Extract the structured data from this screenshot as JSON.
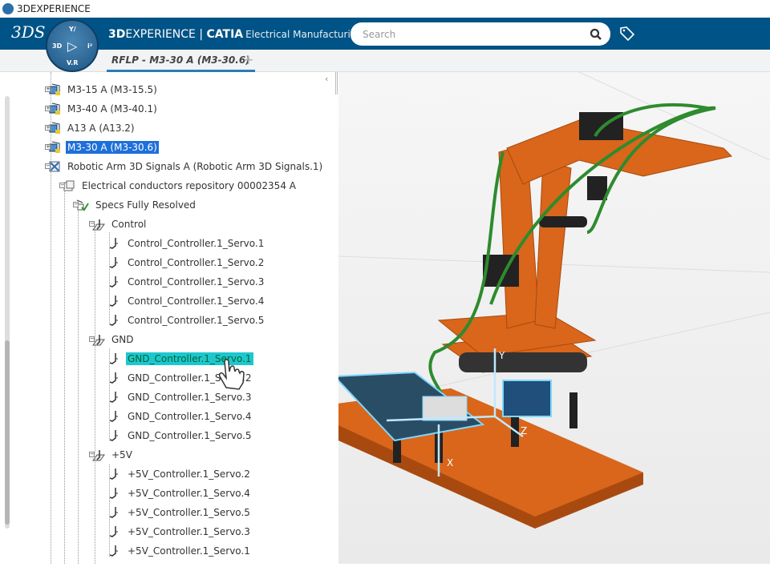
{
  "window": {
    "title": "3DEXPERIENCE"
  },
  "header": {
    "brand_bold": "3D",
    "brand_rest": "EXPERIENCE | ",
    "brand_app": "CATIA",
    "brand_role": "Electrical Manufacturin...",
    "search_placeholder": "Search",
    "compass": {
      "top": "Y/",
      "left": "3D",
      "right": "i²",
      "bottom": "V.R"
    }
  },
  "tabs": [
    {
      "label": "RFLP - M3-30 A (M3-30.6)",
      "active": true
    }
  ],
  "tree": {
    "items": [
      {
        "label": "M3-15 A (M3-15.5)",
        "level": 0,
        "icon": "product-icon"
      },
      {
        "label": "M3-40 A (M3-40.1)",
        "level": 0,
        "icon": "product-icon"
      },
      {
        "label": "A13 A (A13.2)",
        "level": 0,
        "icon": "product-icon"
      },
      {
        "label": "M3-30 A (M3-30.6)",
        "level": 0,
        "icon": "product-icon",
        "selected": true
      },
      {
        "label": "Robotic Arm 3D Signals A (Robotic Arm 3D Signals.1)",
        "level": 0,
        "icon": "signals-icon"
      },
      {
        "label": "Electrical conductors repository 00002354 A",
        "level": 1,
        "icon": "repository-icon"
      },
      {
        "label": "Specs Fully Resolved",
        "level": 2,
        "icon": "specs-icon"
      },
      {
        "label": "Control",
        "level": 3,
        "icon": "signal-group-icon"
      },
      {
        "label": "Control_Controller.1_Servo.1",
        "level": 4,
        "icon": "signal-icon"
      },
      {
        "label": "Control_Controller.1_Servo.2",
        "level": 4,
        "icon": "signal-icon"
      },
      {
        "label": "Control_Controller.1_Servo.3",
        "level": 4,
        "icon": "signal-icon"
      },
      {
        "label": "Control_Controller.1_Servo.4",
        "level": 4,
        "icon": "signal-icon"
      },
      {
        "label": "Control_Controller.1_Servo.5",
        "level": 4,
        "icon": "signal-icon"
      },
      {
        "label": "GND",
        "level": 3,
        "icon": "signal-group-icon"
      },
      {
        "label": "GND_Controller.1_Servo.1",
        "level": 4,
        "icon": "signal-icon",
        "highlighted": true
      },
      {
        "label": "GND_Controller.1_Servo.2",
        "level": 4,
        "icon": "signal-icon"
      },
      {
        "label": "GND_Controller.1_Servo.3",
        "level": 4,
        "icon": "signal-icon"
      },
      {
        "label": "GND_Controller.1_Servo.4",
        "level": 4,
        "icon": "signal-icon"
      },
      {
        "label": "GND_Controller.1_Servo.5",
        "level": 4,
        "icon": "signal-icon"
      },
      {
        "label": "+5V",
        "level": 3,
        "icon": "signal-group-icon"
      },
      {
        "label": "+5V_Controller.1_Servo.2",
        "level": 4,
        "icon": "signal-icon"
      },
      {
        "label": "+5V_Controller.1_Servo.4",
        "level": 4,
        "icon": "signal-icon"
      },
      {
        "label": "+5V_Controller.1_Servo.5",
        "level": 4,
        "icon": "signal-icon"
      },
      {
        "label": "+5V_Controller.1_Servo.3",
        "level": 4,
        "icon": "signal-icon"
      },
      {
        "label": "+5V_Controller.1_Servo.1",
        "level": 4,
        "icon": "signal-icon"
      }
    ]
  },
  "viewport": {
    "axis_labels": {
      "x": "X",
      "y": "Y",
      "z": "Z"
    }
  },
  "colors": {
    "header": "#005386",
    "selection": "#1e6fd9",
    "highlight": "#1ec7cf",
    "model_orange": "#d9661a",
    "wire_green": "#2e8b2e"
  }
}
